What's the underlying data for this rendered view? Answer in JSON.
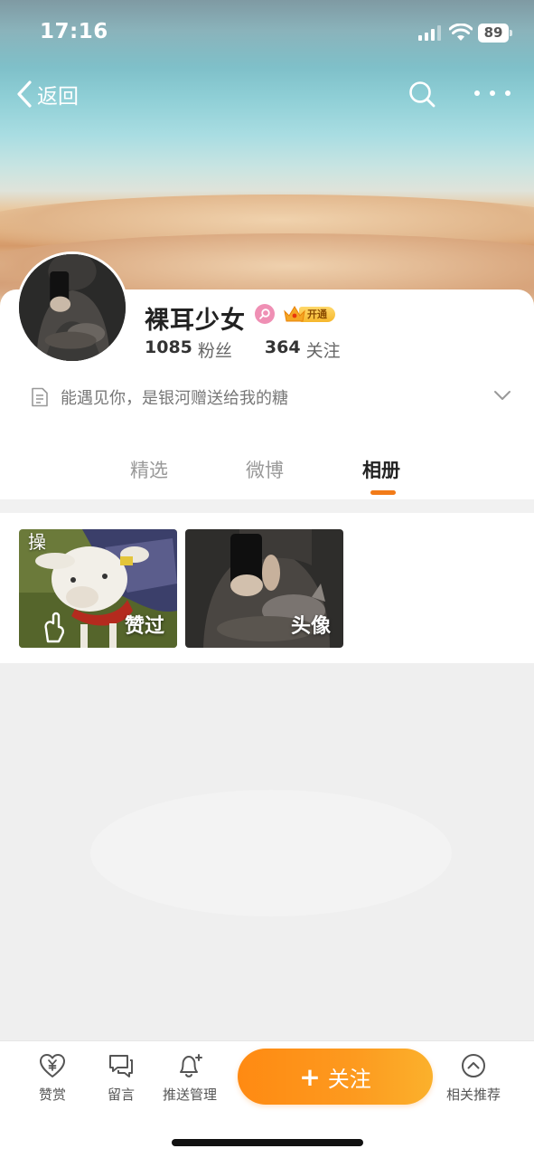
{
  "status_bar": {
    "time": "17:16",
    "battery": "89"
  },
  "nav": {
    "back_label": "返回"
  },
  "profile": {
    "username": "裸耳少女",
    "vip_label": "开通",
    "followers_count": "1085",
    "followers_label": "粉丝",
    "following_count": "364",
    "following_label": "关注",
    "bio": "能遇见你，是银河赠送给我的糖"
  },
  "tabs": [
    {
      "label": "精选",
      "active": false
    },
    {
      "label": "微博",
      "active": false
    },
    {
      "label": "相册",
      "active": true
    }
  ],
  "album": [
    {
      "label": "赞过",
      "corner_text": "操"
    },
    {
      "label": "头像",
      "corner_text": ""
    }
  ],
  "bottom_bar": {
    "reward_label": "赞赏",
    "message_label": "留言",
    "push_label": "推送管理",
    "follow_label": "关注",
    "follow_plus": "+",
    "related_label": "相关推荐"
  },
  "colors": {
    "accent": "#f27b19",
    "follow_gradient_start": "#ff8a12",
    "follow_gradient_end": "#fbb12c"
  }
}
